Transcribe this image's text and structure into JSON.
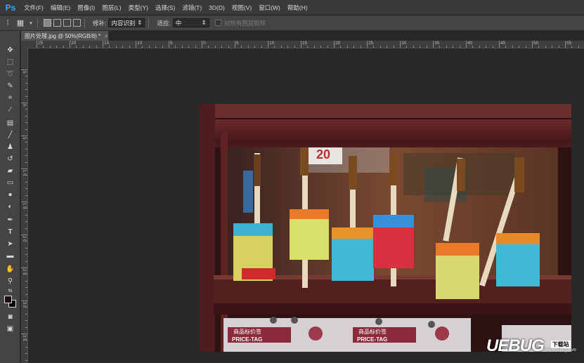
{
  "app": {
    "logo": "Ps",
    "menu": [
      "文件(F)",
      "编辑(E)",
      "图像(I)",
      "图层(L)",
      "类型(Y)",
      "选择(S)",
      "滤镜(T)",
      "3D(D)",
      "视图(V)",
      "窗口(W)",
      "帮助(H)"
    ]
  },
  "options": {
    "repair_label": "修补:",
    "repair_value": "内容识别",
    "adapt_label": "适应:",
    "adapt_value": "中",
    "sample_all_label": "对所有图层取样"
  },
  "document": {
    "tab_title": "图片处理.jpg @ 50%(RGB/8) *",
    "close": "×"
  },
  "ruler": {
    "h_labels": [
      "25",
      "20",
      "15",
      "10",
      "5",
      "0",
      "5",
      "10",
      "15",
      "20",
      "25",
      "30",
      "35",
      "40",
      "45",
      "50",
      "55"
    ],
    "v_labels": [
      "5",
      "0",
      "5",
      "1 0",
      "1 5",
      "2 0",
      "2 5",
      "3 0",
      "3 5"
    ]
  },
  "photo": {
    "sign_number": "20",
    "price_tag_cn": "商品标价签",
    "price_tag_en": "PRICE-TAG"
  },
  "watermark": {
    "text": "UEBUG",
    "badge": "下载站",
    "url": "www.uebug.com"
  },
  "colors": {
    "menubar": "#3a3a3a",
    "panel": "#444444",
    "canvas_bg": "#282828",
    "ps_blue": "#31a8ff"
  }
}
